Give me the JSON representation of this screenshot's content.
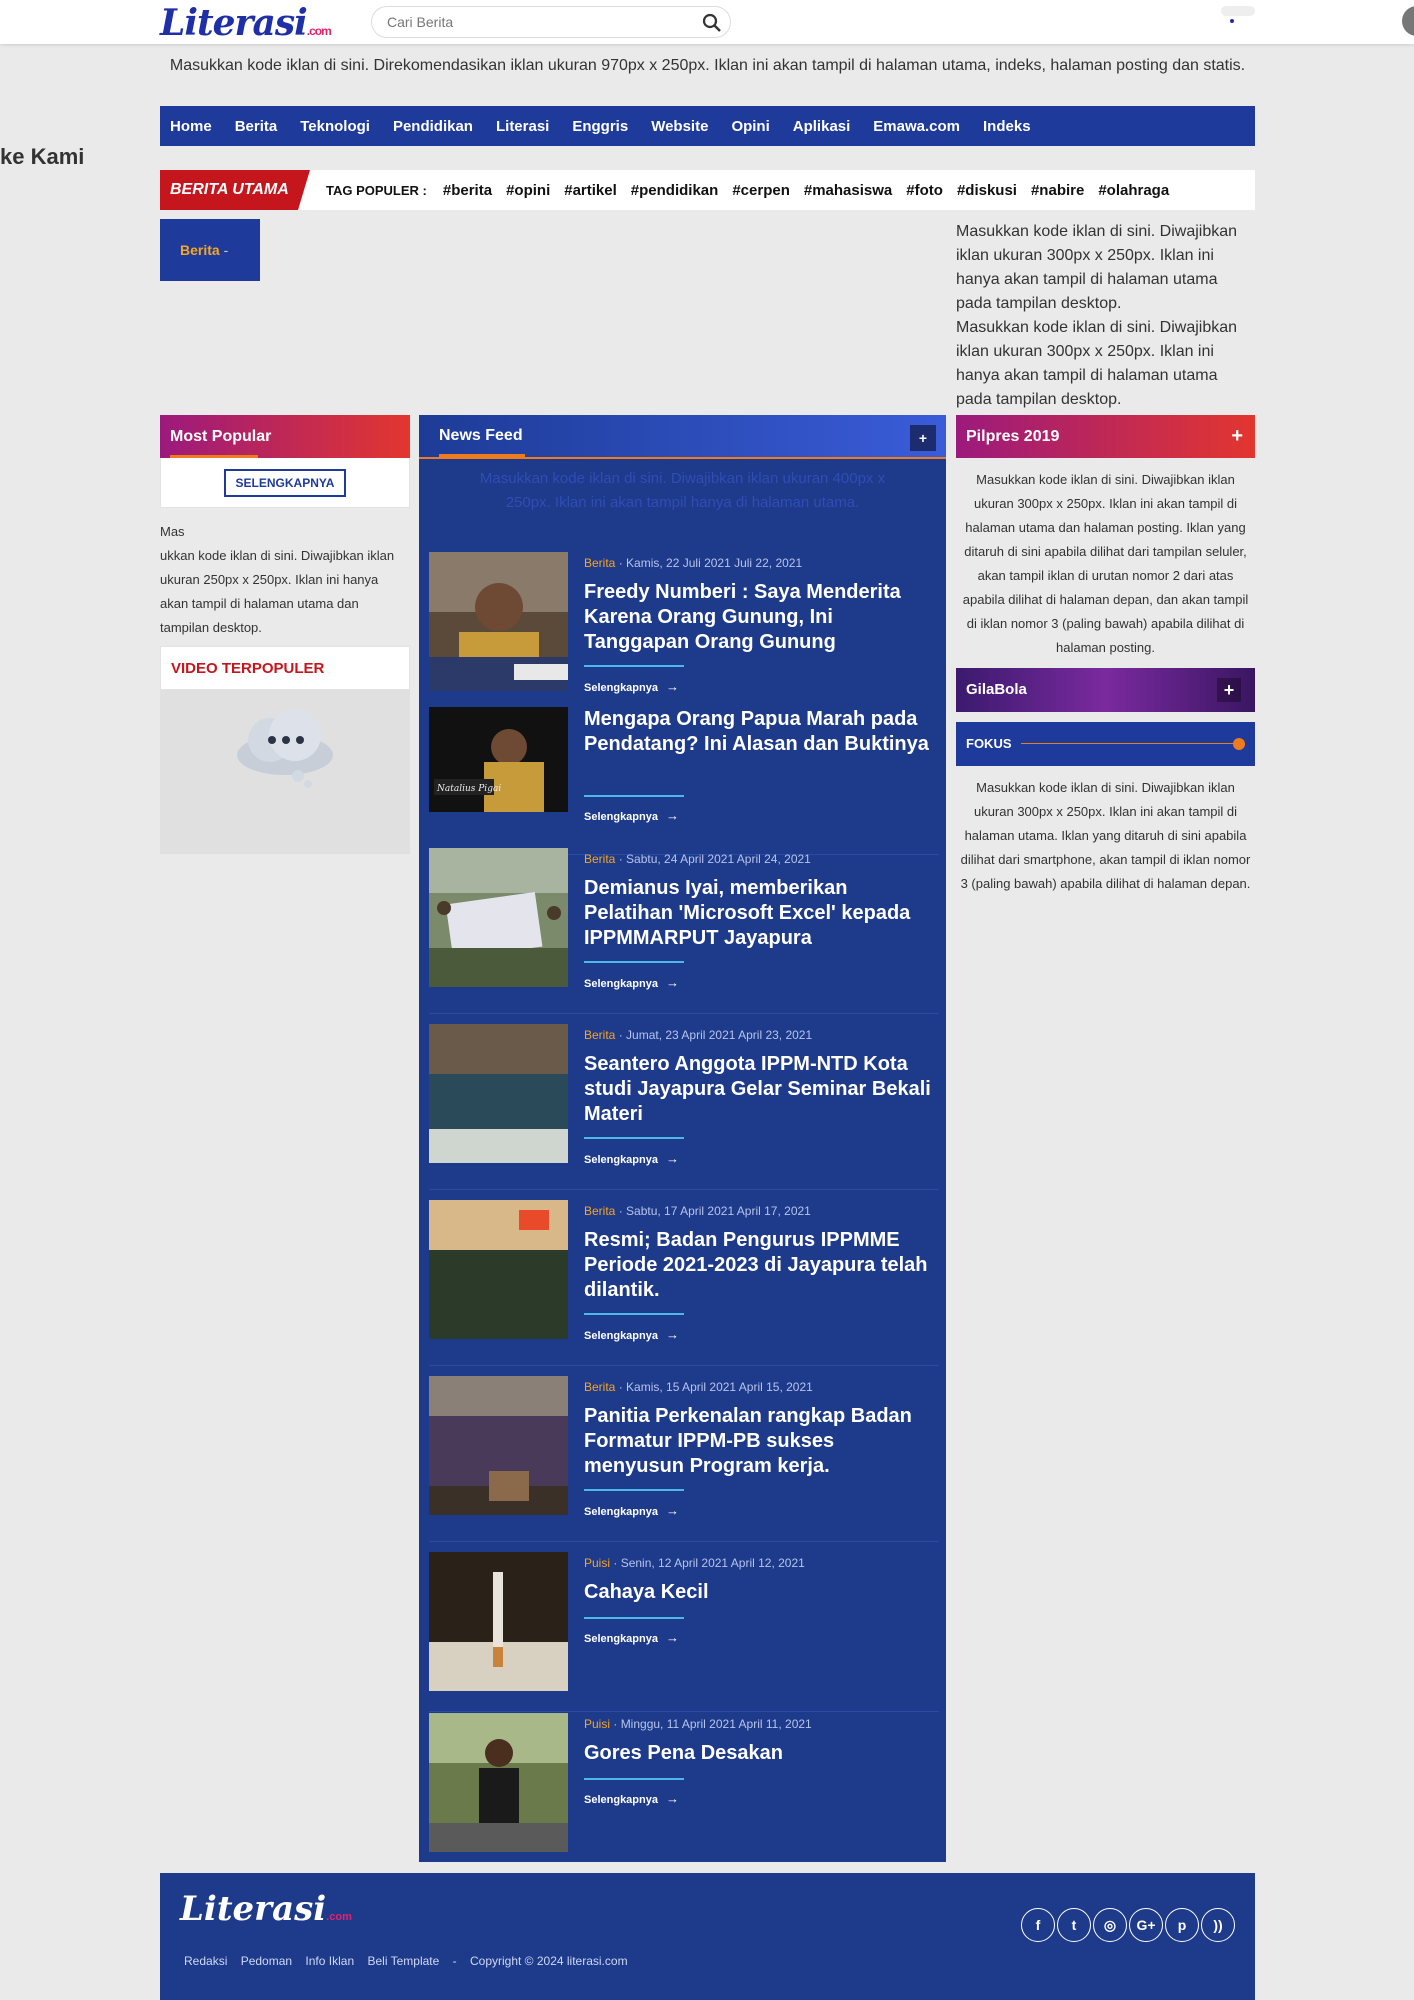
{
  "header": {
    "logo_main": "Literasi",
    "logo_suffix": ".com",
    "search_placeholder": "Cari Berita"
  },
  "left_clip_text": "ke Kami",
  "ads": {
    "top": "Masukkan kode iklan di sini. Direkomendasikan iklan ukuran 970px x 250px. Iklan ini akan tampil di halaman utama, indeks, halaman posting dan statis.",
    "right_top_1": "Masukkan kode iklan di sini. Diwajibkan iklan ukuran 300px x 250px. Iklan ini hanya akan tampil di halaman utama pada tampilan desktop.",
    "right_top_2": "Masukkan kode iklan di sini. Diwajibkan iklan ukuran 300px x 250px. Iklan ini hanya akan tampil di halaman utama pada tampilan desktop.",
    "left": "Mas\nukkan kode iklan di sini. Diwajibkan iklan ukuran 250px x 250px. Iklan ini hanya akan tampil di halaman utama dan tampilan desktop.",
    "feed": "Masukkan kode iklan di sini. Diwajibkan iklan ukuran 400px x 250px. Iklan ini akan tampil hanya di halaman utama.",
    "pilpres": "Masukkan kode iklan di sini. Diwajibkan iklan ukuran 300px x 250px. Iklan ini akan tampil di halaman utama dan halaman posting. Iklan yang ditaruh di sini apabila dilihat dari tampilan seluler, akan tampil iklan di urutan nomor 2 dari atas apabila dilihat di halaman depan, dan akan tampil di iklan nomor 3 (paling bawah) apabila dilihat di halaman posting.",
    "fokus": "Masukkan kode iklan di sini. Diwajibkan iklan ukuran 300px x 250px. Iklan ini akan tampil di halaman utama. Iklan yang ditaruh di sini apabila dilihat dari smartphone, akan tampil di iklan nomor 3 (paling bawah) apabila dilihat di halaman depan."
  },
  "nav": [
    "Home",
    "Berita",
    "Teknologi",
    "Pendidikan",
    "Literasi",
    "Enggris",
    "Website",
    "Opini",
    "Aplikasi",
    "Emawa.com",
    "Indeks"
  ],
  "tagbar": {
    "badge": "BERITA UTAMA",
    "title": "TAG POPULER :",
    "tags": [
      "#berita",
      "#opini",
      "#artikel",
      "#pendidikan",
      "#cerpen",
      "#mahasiswa",
      "#foto",
      "#diskusi",
      "#nabire",
      "#olahraga"
    ]
  },
  "berita_box": {
    "label": "Berita",
    "dash": " -"
  },
  "most_popular": {
    "title": "Most Popular",
    "button": "SELENGKAPNYA"
  },
  "video": {
    "title": "VIDEO TERPOPULER"
  },
  "feed": {
    "title": "News Feed",
    "plus": "+",
    "more_label": "Selengkapnya",
    "items": [
      {
        "cat": "Berita",
        "date": "· Kamis, 22 Juli 2021 Juli 22, 2021",
        "title": "Freedy Numberi : Saya Menderita Karena Orang Gunung, Ini Tanggapan Orang Gunung"
      },
      {
        "cat": "",
        "date": "",
        "title": "Mengapa Orang Papua Marah pada Pendatang? Ini Alasan dan Buktinya"
      },
      {
        "cat": "Berita",
        "date": "· Sabtu, 24 April 2021 April 24, 2021",
        "title": "Demianus Iyai, memberikan Pelatihan 'Microsoft Excel' kepada IPPMMARPUT Jayapura"
      },
      {
        "cat": "Berita",
        "date": "· Jumat, 23 April 2021 April 23, 2021",
        "title": "Seantero Anggota IPPM-NTD Kota studi Jayapura Gelar Seminar Bekali Materi"
      },
      {
        "cat": "Berita",
        "date": "· Sabtu, 17 April 2021 April 17, 2021",
        "title": "Resmi; Badan Pengurus IPPMME Periode 2021-2023 di Jayapura telah dilantik."
      },
      {
        "cat": "Berita",
        "date": "· Kamis, 15 April 2021 April 15, 2021",
        "title": "Panitia Perkenalan rangkap Badan Formatur IPPM-PB sukses menyusun Program kerja."
      },
      {
        "cat": "Puisi",
        "date": "· Senin, 12 April 2021 April 12, 2021",
        "title": "Cahaya Kecil"
      },
      {
        "cat": "Puisi",
        "date": "· Minggu, 11 April 2021 April 11, 2021",
        "title": "Gores Pena Desakan"
      }
    ]
  },
  "right": {
    "pilpres_title": "Pilpres 2019",
    "gila_title": "GilaBola",
    "fokus_title": "FOKUS"
  },
  "footer": {
    "logo_main": "Literasi",
    "logo_suffix": ".com",
    "links": [
      "Redaksi",
      "Pedoman",
      "Info Iklan",
      "Beli Template",
      "-",
      "Copyright © 2024 literasi.com"
    ],
    "socials": [
      "f",
      "t",
      "ig",
      "G+",
      "p",
      "rss"
    ]
  }
}
